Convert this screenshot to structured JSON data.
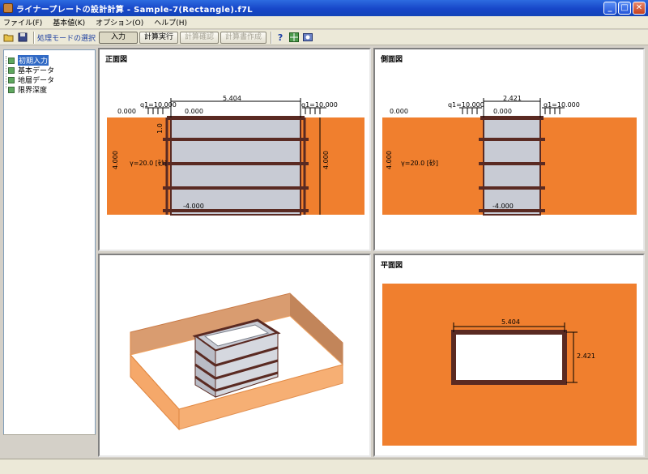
{
  "window": {
    "title": "ライナープレートの設計計算 - Sample-7(Rectangle).f7L",
    "min_label": "_",
    "max_label": "□",
    "close_label": "✕"
  },
  "menu": [
    "ファイル(F)",
    "基本値(K)",
    "オプション(O)",
    "ヘルプ(H)"
  ],
  "toolbar": {
    "mode_label": "処理モードの選択",
    "input_label": "入力",
    "calc_run_label": "計算実行",
    "calc_check_label": "計算確認",
    "report_label": "計算書作成"
  },
  "tree": [
    "初期入力",
    "基本データ",
    "地層データ",
    "限界深度"
  ],
  "front_view": {
    "title": "正面図",
    "width": "5.404",
    "q_left": "q1=10.000",
    "q_right": "q1=10.000",
    "top_left": "0.000",
    "top_inner": "0.000",
    "depth_left": "4.000",
    "depth_right": "4.000",
    "ring_spacing": "1.0",
    "bottom": "-4.000",
    "soil": "γ=20.0 [砂]"
  },
  "side_view": {
    "title": "側面図",
    "width": "2.421",
    "q_left": "q1=10.000",
    "q_right": "q1=10.000",
    "top_left": "0.000",
    "top_inner": "0.000",
    "depth_left": "4.000",
    "bottom": "-4.000",
    "soil": "γ=20.0 [砂]"
  },
  "plan_view": {
    "title": "平面図",
    "width": "5.404",
    "height": "2.421"
  },
  "colors": {
    "soil": "#f07f2e",
    "steel": "#5a2a22",
    "panel_fill": "#c8cbd4"
  }
}
